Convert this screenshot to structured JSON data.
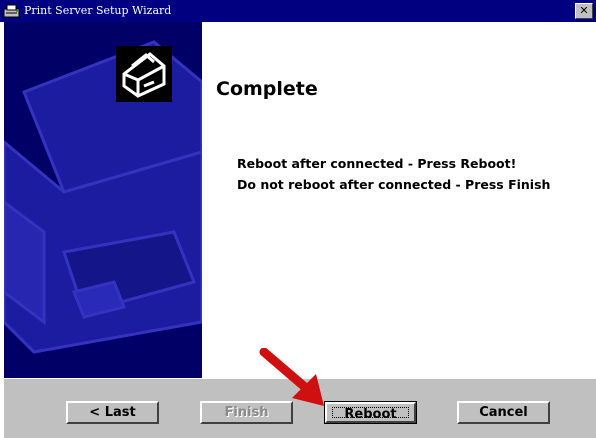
{
  "window": {
    "title": "Print Server Setup Wizard",
    "close_glyph": "✕"
  },
  "main": {
    "heading": "Complete",
    "line1": "Reboot after connected - Press Reboot!",
    "line2": "Do not reboot after connected - Press Finish"
  },
  "buttons": {
    "last": "< Last",
    "finish": "Finish",
    "reboot": "Reboot",
    "cancel": "Cancel"
  },
  "colors": {
    "titlebar": "#000080",
    "side_panel": "#000066",
    "button_face": "#c0c0c0",
    "annotation_arrow": "#d01010"
  },
  "icons": {
    "title": "wizard-app-icon",
    "side": "printer-icon",
    "annotation": "red-arrow-icon"
  }
}
